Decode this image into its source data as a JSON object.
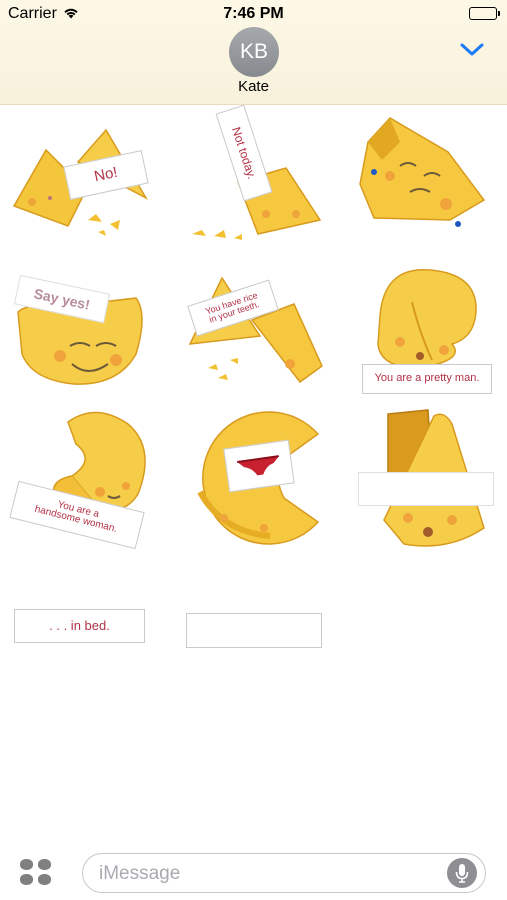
{
  "status_bar": {
    "carrier": "Carrier",
    "time": "7:46 PM",
    "wifi_icon": "wifi-icon",
    "battery_icon": "battery-icon",
    "battery_level": 1.0
  },
  "header": {
    "avatar_initials": "KB",
    "contact_name": "Kate",
    "collapse_icon": "chevron-down-icon",
    "accent_color": "#1a7cf5"
  },
  "stickers": [
    {
      "name": "sticker-no",
      "caption": "No!"
    },
    {
      "name": "sticker-not-today",
      "caption": "Not today."
    },
    {
      "name": "sticker-worried-cookie",
      "caption": ""
    },
    {
      "name": "sticker-say-yes",
      "caption": "Say yes!"
    },
    {
      "name": "sticker-rice-in-teeth",
      "caption_line1": "You have rice",
      "caption_line2": "in your teeth."
    },
    {
      "name": "sticker-pretty-man",
      "caption": "You are a pretty man."
    },
    {
      "name": "sticker-handsome-woman",
      "caption_line1": "You are a",
      "caption_line2": "handsome woman."
    },
    {
      "name": "sticker-underwear",
      "caption": ""
    },
    {
      "name": "sticker-surprised-cookie",
      "caption": ""
    },
    {
      "name": "sticker-in-bed",
      "caption": ". . . in bed."
    },
    {
      "name": "sticker-blank-note",
      "caption": ""
    }
  ],
  "compose": {
    "placeholder": "iMessage",
    "apps_icon": "app-drawer-icon",
    "mic_icon": "microphone-icon"
  }
}
